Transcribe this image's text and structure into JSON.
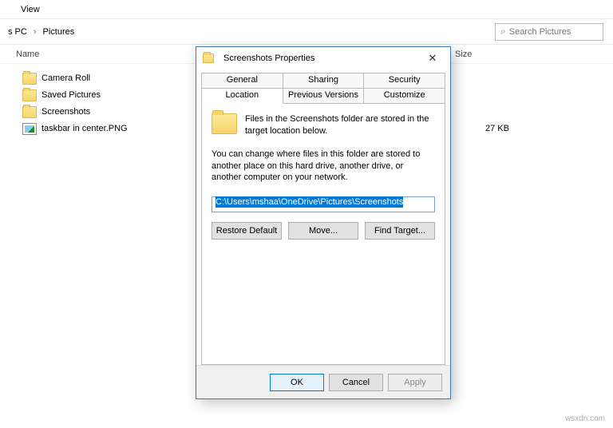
{
  "menubar": {
    "view": "View"
  },
  "breadcrumb": {
    "pc": "s PC",
    "folder": "Pictures"
  },
  "search": {
    "placeholder": "Search Pictures"
  },
  "columns": {
    "name": "Name",
    "size": "Size"
  },
  "files": [
    {
      "name": "Camera Roll",
      "type": "folder",
      "size": ""
    },
    {
      "name": "Saved Pictures",
      "type": "folder",
      "size": ""
    },
    {
      "name": "Screenshots",
      "type": "folder",
      "size": ""
    },
    {
      "name": "taskbar in center.PNG",
      "type": "png",
      "size": "27 KB"
    }
  ],
  "dialog": {
    "title": "Screenshots Properties",
    "tabs_row1": [
      "General",
      "Sharing",
      "Security"
    ],
    "tabs_row2": [
      "Location",
      "Previous Versions",
      "Customize"
    ],
    "active_tab": "Location",
    "desc1": "Files in the Screenshots folder are stored in the target location below.",
    "desc2": "You can change where files in this folder are stored to another place on this hard drive, another drive, or another computer on your network.",
    "path": "C:\\Users\\mshaa\\OneDrive\\Pictures\\Screenshots",
    "buttons": {
      "restore": "Restore Default",
      "move": "Move...",
      "find": "Find Target..."
    },
    "footer": {
      "ok": "OK",
      "cancel": "Cancel",
      "apply": "Apply"
    }
  },
  "watermark": "wsxdn.com"
}
